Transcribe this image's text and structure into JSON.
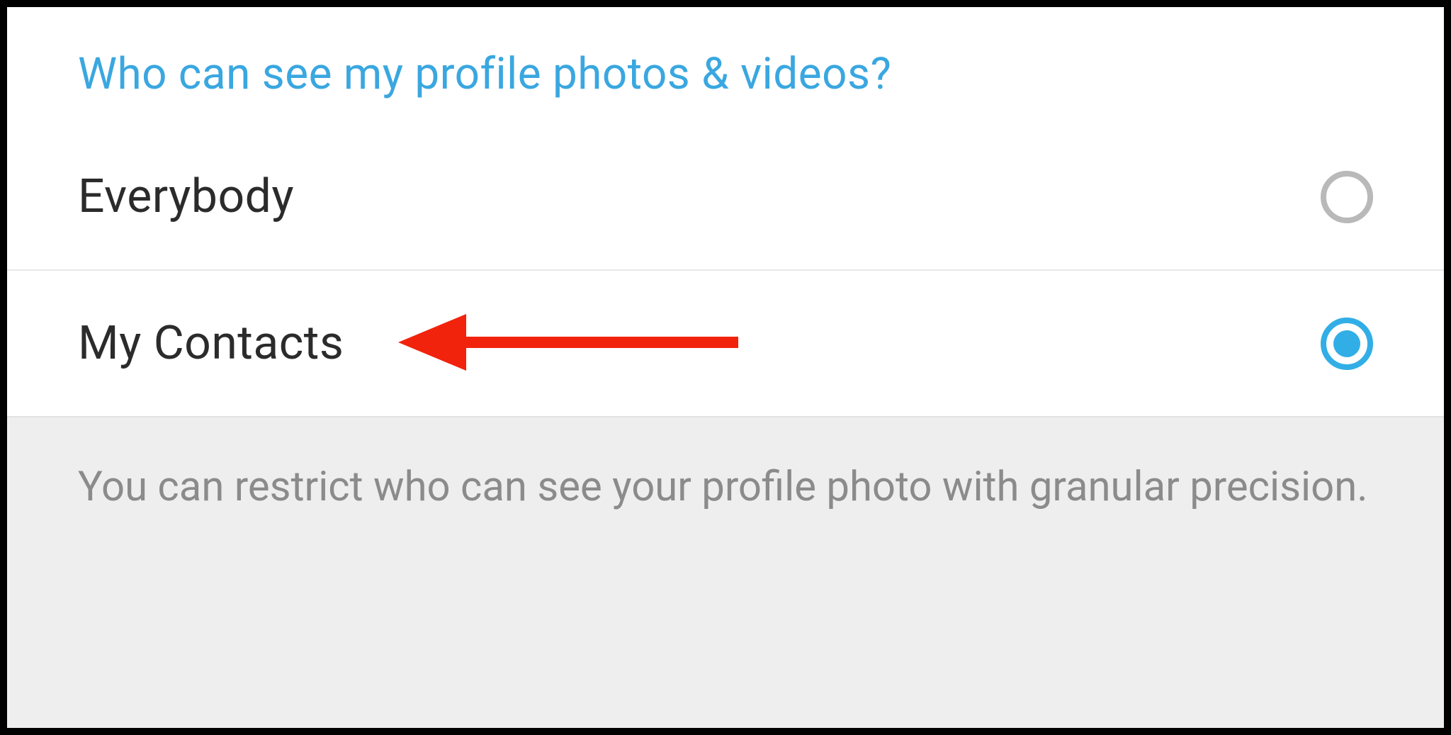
{
  "section": {
    "title": "Who can see my profile photos & videos?"
  },
  "options": [
    {
      "label": "Everybody",
      "selected": false
    },
    {
      "label": "My Contacts",
      "selected": true
    }
  ],
  "footer": {
    "text": "You can restrict who can see your profile photo with granular precision."
  },
  "annotation": {
    "arrow_points_to": "My Contacts"
  },
  "colors": {
    "accent": "#32aee6",
    "title": "#3aa7e0",
    "muted": "#8b8b8b",
    "arrow": "#f2230c"
  }
}
